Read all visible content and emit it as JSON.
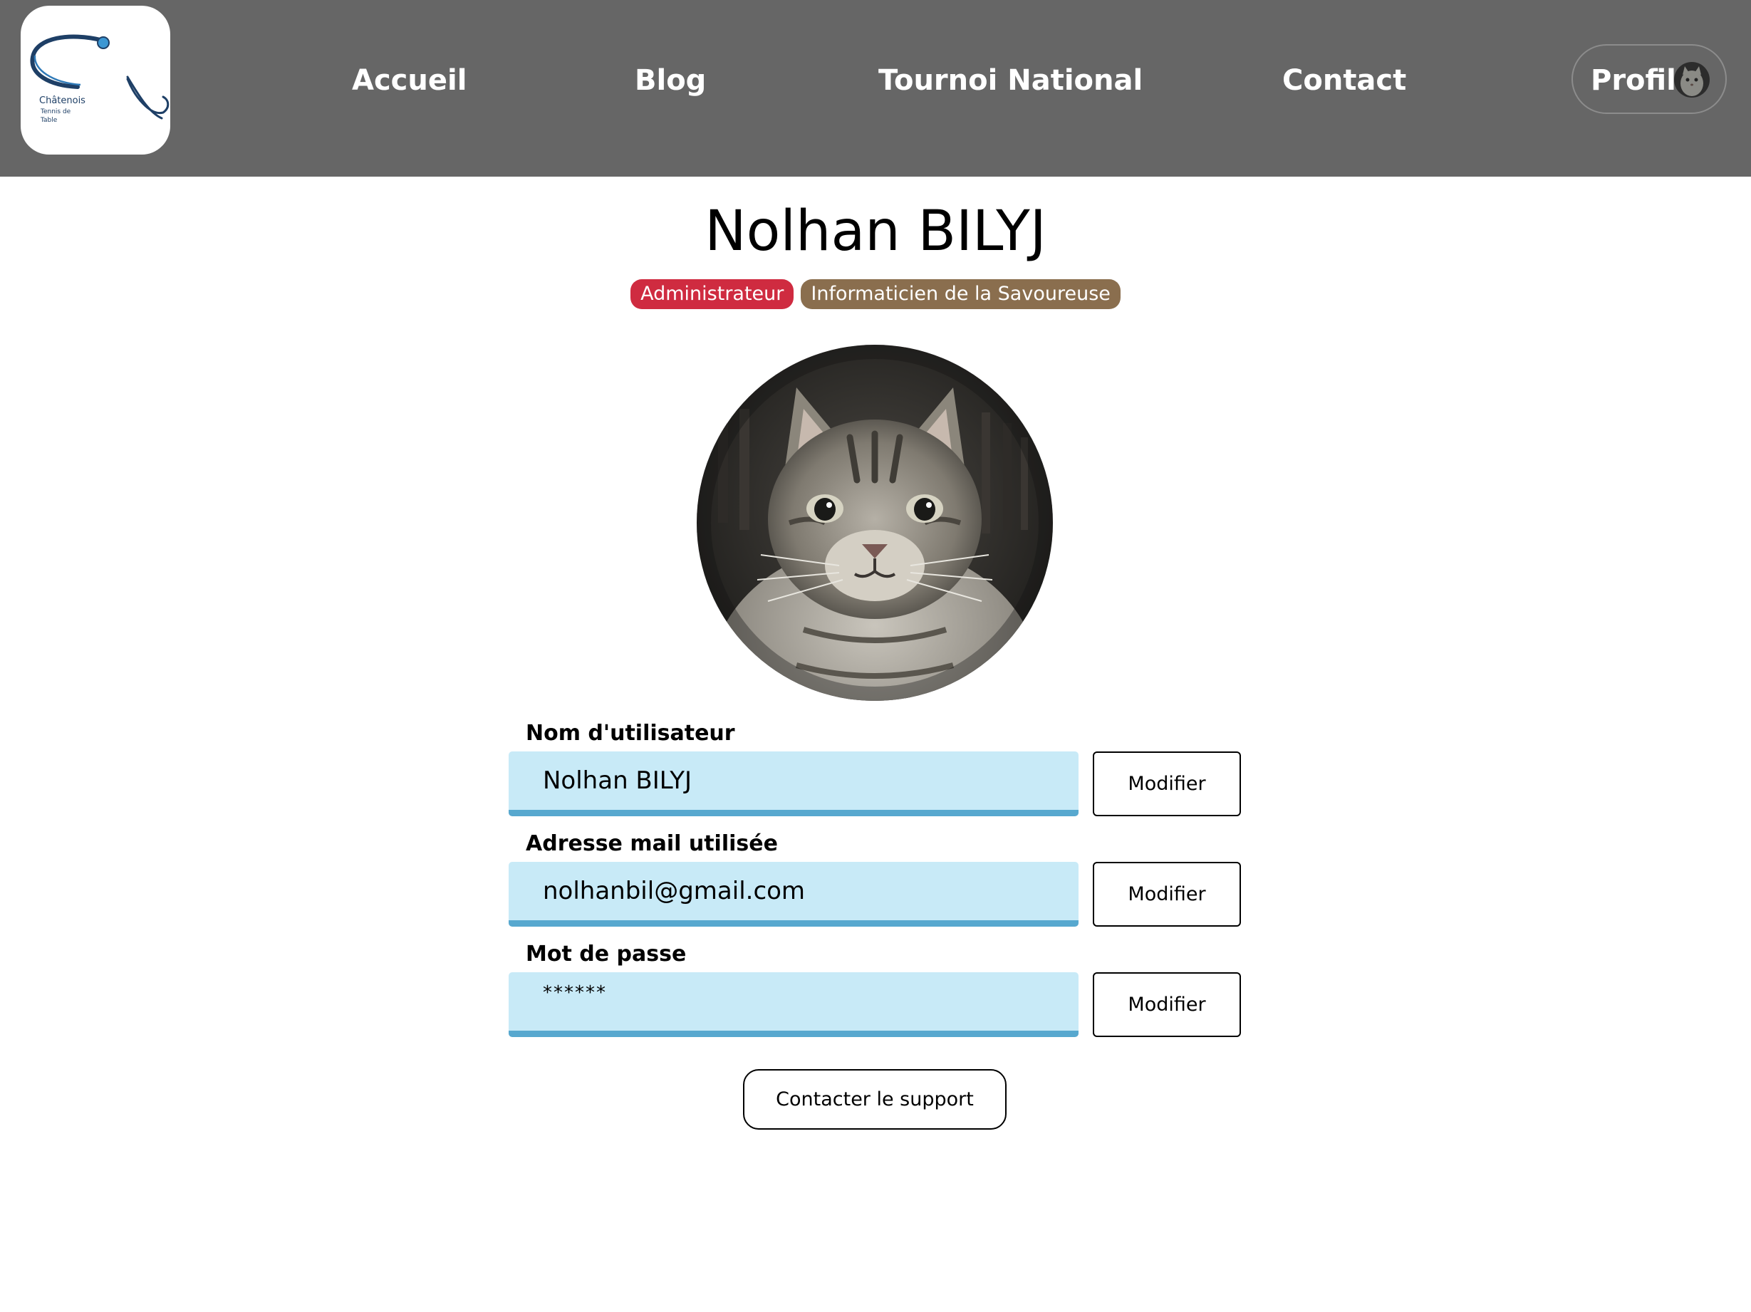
{
  "header": {
    "logo": {
      "icon": "club-logo",
      "text_line1": "Châtenois",
      "text_line2": "Tennis de",
      "text_line3": "Table"
    },
    "nav": {
      "accueil": "Accueil",
      "blog": "Blog",
      "tournoi": "Tournoi National",
      "contact": "Contact"
    },
    "profil_label": "Profil",
    "profil_avatar_icon": "cat-avatar"
  },
  "profile": {
    "name": "Nolhan BILYJ",
    "badges": {
      "role": "Administrateur",
      "title": "Informaticien de la Savoureuse"
    },
    "avatar_icon": "cat-photo"
  },
  "fields": {
    "username": {
      "label": "Nom d'utilisateur",
      "value": "Nolhan BILYJ",
      "button": "Modifier"
    },
    "email": {
      "label": "Adresse mail utilisée",
      "value": "nolhanbil@gmail.com",
      "button": "Modifier"
    },
    "password": {
      "label": "Mot de passe",
      "value": "******",
      "button": "Modifier"
    }
  },
  "support_button": "Contacter le support",
  "colors": {
    "header_bg": "#666666",
    "badge_admin": "#cf2b40",
    "badge_info": "#8a6e4e",
    "input_bg": "#c8eaf7",
    "input_border": "#57a8cf"
  }
}
